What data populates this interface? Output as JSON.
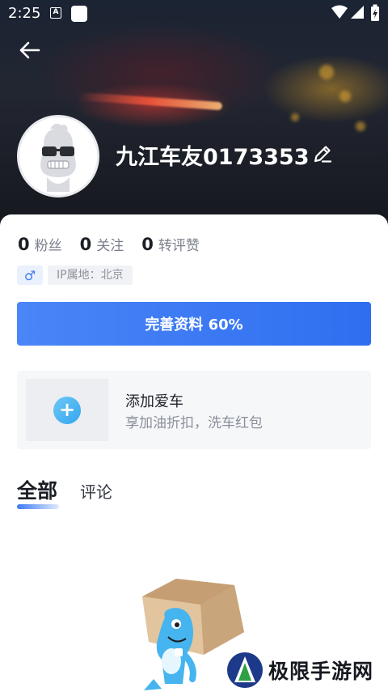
{
  "status_bar": {
    "time": "2:25"
  },
  "profile": {
    "username": "九江车友0173353",
    "ip_location": "IP属地：北京",
    "gender_symbol": "♂"
  },
  "stats": [
    {
      "value": "0",
      "label": "粉丝"
    },
    {
      "value": "0",
      "label": "关注"
    },
    {
      "value": "0",
      "label": "转评赞"
    }
  ],
  "complete_profile": {
    "label": "完善资料 60%",
    "progress_percent": 60
  },
  "add_car": {
    "title": "添加爱车",
    "subtitle": "享加油折扣，洗车红包"
  },
  "tabs": {
    "all": "全部",
    "comments": "评论"
  },
  "watermark": {
    "text": "极限手游网"
  },
  "colors": {
    "primary_blue": "#3d7bf5",
    "stat_label": "#7a7f8b"
  }
}
